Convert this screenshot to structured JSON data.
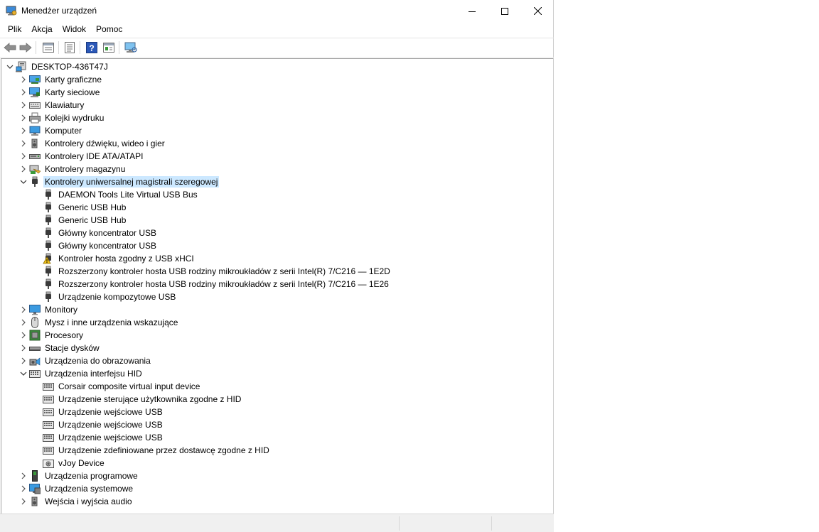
{
  "window": {
    "title": "Menedżer urządzeń"
  },
  "menu": [
    "Plik",
    "Akcja",
    "Widok",
    "Pomoc"
  ],
  "toolbar": [
    "back-icon",
    "forward-icon",
    "properties-view-icon",
    "list-view-icon",
    "help-icon",
    "update-driver-icon",
    "scan-hardware-icon"
  ],
  "tree": {
    "root": "DESKTOP-436T47J",
    "items": [
      {
        "label": "Karty graficzne",
        "icon": "display-adapter-icon",
        "expanded": false
      },
      {
        "label": "Karty sieciowe",
        "icon": "network-adapter-icon",
        "expanded": false
      },
      {
        "label": "Klawiatury",
        "icon": "keyboard-icon",
        "expanded": false
      },
      {
        "label": "Kolejki wydruku",
        "icon": "printer-icon",
        "expanded": false
      },
      {
        "label": "Komputer",
        "icon": "computer-icon",
        "expanded": false
      },
      {
        "label": "Kontrolery dźwięku, wideo i gier",
        "icon": "speaker-icon",
        "expanded": false
      },
      {
        "label": "Kontrolery IDE ATA/ATAPI",
        "icon": "ide-controller-icon",
        "expanded": false
      },
      {
        "label": "Kontrolery magazynu",
        "icon": "storage-controller-icon",
        "expanded": false
      },
      {
        "label": "Kontrolery uniwersalnej magistrali szeregowej",
        "icon": "usb-icon",
        "expanded": true,
        "selected": true,
        "children": [
          {
            "label": "DAEMON Tools Lite Virtual USB Bus",
            "icon": "usb-icon"
          },
          {
            "label": "Generic USB Hub",
            "icon": "usb-icon"
          },
          {
            "label": "Generic USB Hub",
            "icon": "usb-icon"
          },
          {
            "label": "Główny koncentrator USB",
            "icon": "usb-icon"
          },
          {
            "label": "Główny koncentrator USB",
            "icon": "usb-icon"
          },
          {
            "label": "Kontroler hosta zgodny z USB xHCI",
            "icon": "usb-warning-icon"
          },
          {
            "label": "Rozszerzony kontroler hosta USB rodziny mikroukładów z serii Intel(R) 7/C216 — 1E2D",
            "icon": "usb-icon"
          },
          {
            "label": "Rozszerzony kontroler hosta USB rodziny mikroukładów z serii Intel(R) 7/C216 — 1E26",
            "icon": "usb-icon"
          },
          {
            "label": "Urządzenie kompozytowe USB",
            "icon": "usb-icon"
          }
        ]
      },
      {
        "label": "Monitory",
        "icon": "monitor-icon",
        "expanded": false
      },
      {
        "label": "Mysz i inne urządzenia wskazujące",
        "icon": "mouse-icon",
        "expanded": false
      },
      {
        "label": "Procesory",
        "icon": "processor-icon",
        "expanded": false
      },
      {
        "label": "Stacje dysków",
        "icon": "disk-drive-icon",
        "expanded": false
      },
      {
        "label": "Urządzenia do obrazowania",
        "icon": "imaging-device-icon",
        "expanded": false
      },
      {
        "label": "Urządzenia interfejsu HID",
        "icon": "hid-icon",
        "expanded": true,
        "children": [
          {
            "label": "Corsair composite virtual input device",
            "icon": "hid-icon"
          },
          {
            "label": "Urządzenie sterujące użytkownika zgodne z HID",
            "icon": "hid-icon"
          },
          {
            "label": "Urządzenie wejściowe USB",
            "icon": "hid-icon"
          },
          {
            "label": "Urządzenie wejściowe USB",
            "icon": "hid-icon"
          },
          {
            "label": "Urządzenie wejściowe USB",
            "icon": "hid-icon"
          },
          {
            "label": "Urządzenie zdefiniowane przez dostawcę zgodne z HID",
            "icon": "hid-icon"
          },
          {
            "label": "vJoy Device",
            "icon": "joystick-icon"
          }
        ]
      },
      {
        "label": "Urządzenia programowe",
        "icon": "software-device-icon",
        "expanded": false
      },
      {
        "label": "Urządzenia systemowe",
        "icon": "system-device-icon",
        "expanded": false
      },
      {
        "label": "Wejścia i wyjścia audio",
        "icon": "audio-io-icon",
        "expanded": false
      }
    ]
  },
  "colors": {
    "selection": "#cce8ff",
    "accent": "#0078d7"
  }
}
